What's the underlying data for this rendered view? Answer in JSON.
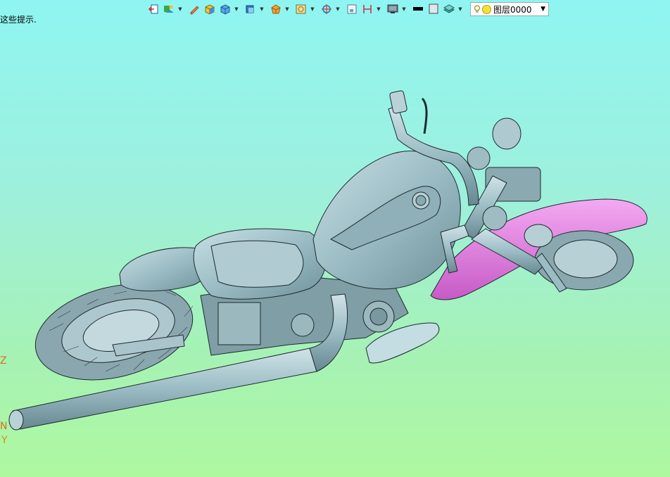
{
  "hint_text": "这些提示.",
  "layer": {
    "name": "图层0000"
  },
  "axes": {
    "z": "Z",
    "n": "N",
    "y": "Y"
  },
  "colors": {
    "body": "#9bbcc4",
    "fender": "#e483e3",
    "line": "#1d2a2e"
  },
  "toolbar_icons": [
    "exit-icon",
    "view-mode-icon",
    "pen-icon",
    "cube-yellow-icon",
    "cube-blue-icon",
    "cube-face-icon",
    "render-icon",
    "camera-target-icon",
    "rotate-icon",
    "frame-icon",
    "measure-icon",
    "monitor-icon",
    "line-color-icon",
    "fill-color-icon",
    "layer-stack-icon"
  ]
}
